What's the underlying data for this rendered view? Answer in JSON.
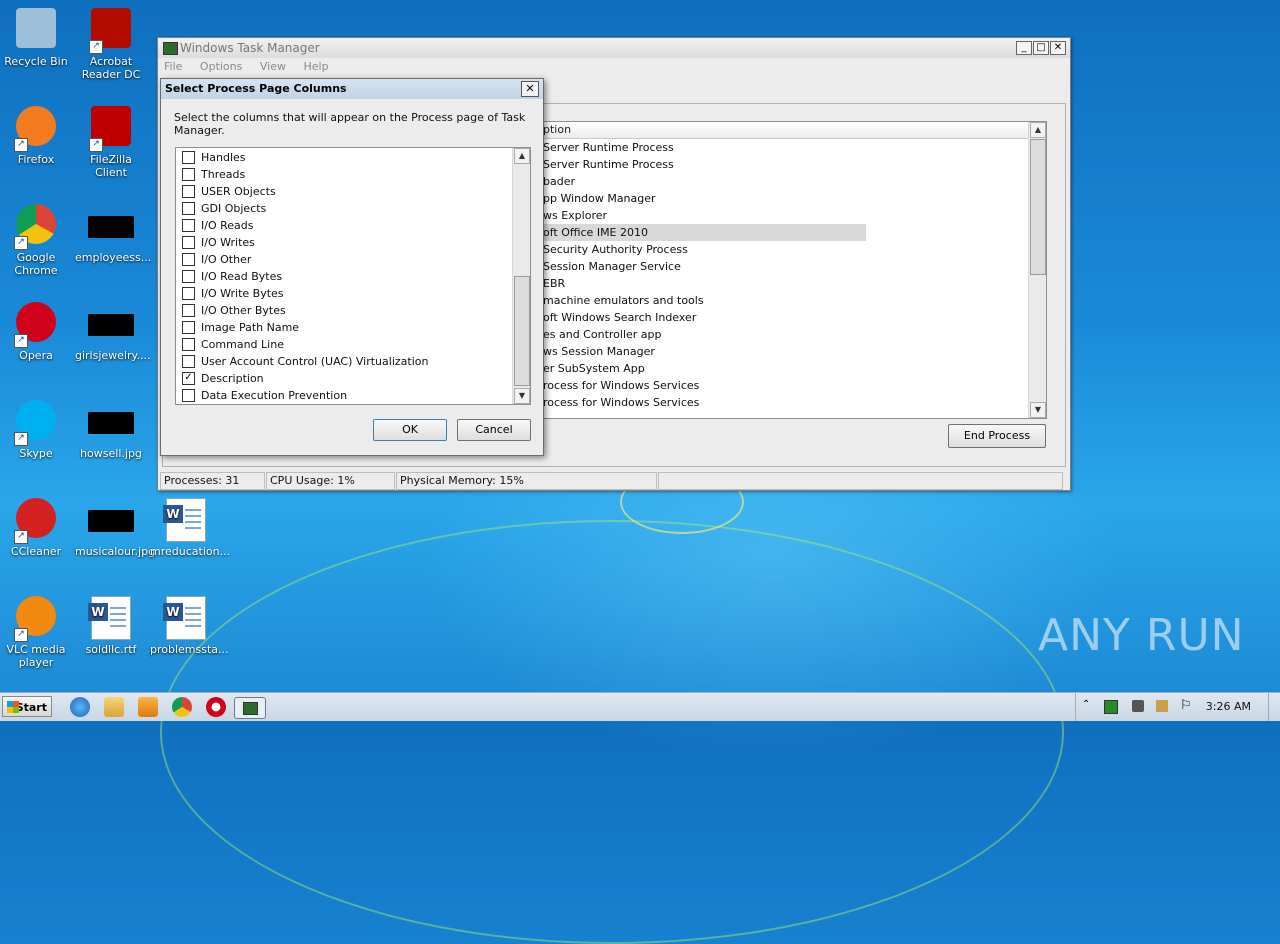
{
  "desktop": {
    "icons": [
      {
        "label": "Recycle Bin"
      },
      {
        "label": "Acrobat Reader DC"
      },
      {
        "label": "Firefox"
      },
      {
        "label": "FileZilla Client"
      },
      {
        "label": "Google Chrome"
      },
      {
        "label": "employeess..."
      },
      {
        "label": "Opera"
      },
      {
        "label": "girlsjewelry...."
      },
      {
        "label": "Skype"
      },
      {
        "label": "howsell.jpg"
      },
      {
        "label": "CCleaner"
      },
      {
        "label": "musicalour.jpg"
      },
      {
        "label": "mreducation..."
      },
      {
        "label": "VLC media player"
      },
      {
        "label": "soldllc.rtf"
      },
      {
        "label": "problemssta..."
      }
    ],
    "watermark": "ANY RUN"
  },
  "task_manager": {
    "title": "Windows Task Manager",
    "menu": [
      "File",
      "Options",
      "View",
      "Help"
    ],
    "column_header": "ption",
    "rows": [
      "Server Runtime Process",
      "Server Runtime Process",
      "bader",
      "pp Window Manager",
      "ws Explorer",
      "oft Office IME 2010",
      "Security Authority Process",
      "Session Manager Service",
      "EBR",
      "machine emulators and tools",
      "oft Windows Search Indexer",
      "es and Controller app",
      "ws Session Manager",
      "er SubSystem App",
      "rocess for Windows Services",
      "rocess for Windows Services"
    ],
    "selected_row_index": 5,
    "end_process_label": "End Process",
    "status": {
      "processes": "Processes: 31",
      "cpu": "CPU Usage: 1%",
      "memory": "Physical Memory: 15%"
    }
  },
  "dialog": {
    "title": "Select Process Page Columns",
    "instruction": "Select the columns that will appear on the Process page of Task Manager.",
    "columns": [
      {
        "label": "Handles",
        "checked": false
      },
      {
        "label": "Threads",
        "checked": false
      },
      {
        "label": "USER Objects",
        "checked": false
      },
      {
        "label": "GDI Objects",
        "checked": false
      },
      {
        "label": "I/O Reads",
        "checked": false
      },
      {
        "label": "I/O Writes",
        "checked": false
      },
      {
        "label": "I/O Other",
        "checked": false
      },
      {
        "label": "I/O Read Bytes",
        "checked": false
      },
      {
        "label": "I/O Write Bytes",
        "checked": false
      },
      {
        "label": "I/O Other Bytes",
        "checked": false
      },
      {
        "label": "Image Path Name",
        "checked": false
      },
      {
        "label": "Command Line",
        "checked": false
      },
      {
        "label": "User Account Control (UAC) Virtualization",
        "checked": false
      },
      {
        "label": "Description",
        "checked": true
      },
      {
        "label": "Data Execution Prevention",
        "checked": false
      }
    ],
    "ok_label": "OK",
    "cancel_label": "Cancel"
  },
  "taskbar": {
    "start_label": "Start",
    "clock": "3:26 AM"
  }
}
